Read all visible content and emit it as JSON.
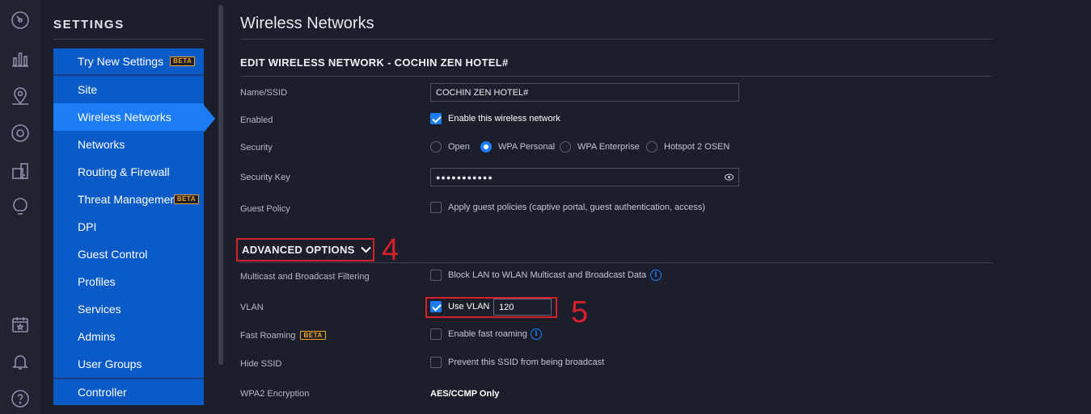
{
  "rail": {
    "icons": [
      "dashboard-icon",
      "statistics-icon",
      "map-icon",
      "devices-icon",
      "clients-icon",
      "insights-icon",
      "events-icon",
      "alerts-icon",
      "help-icon"
    ]
  },
  "nav": {
    "title": "SETTINGS",
    "try_new": "Try New Settings",
    "beta": "BETA",
    "items": [
      "Site",
      "Wireless Networks",
      "Networks",
      "Routing & Firewall",
      "Threat Management",
      "DPI",
      "Guest Control",
      "Profiles",
      "Services",
      "Admins",
      "User Groups"
    ],
    "controller": "Controller",
    "active": "Wireless Networks"
  },
  "main": {
    "page_title": "Wireless Networks",
    "section_title": "EDIT WIRELESS NETWORK - COCHIN ZEN HOTEL#",
    "fields": {
      "name_label": "Name/SSID",
      "name_value": "COCHIN ZEN HOTEL#",
      "enabled_label": "Enabled",
      "enabled_text": "Enable this wireless network",
      "enabled_checked": true,
      "security_label": "Security",
      "security_options": [
        "Open",
        "WPA Personal",
        "WPA Enterprise",
        "Hotspot 2 OSEN"
      ],
      "security_selected": "WPA Personal",
      "key_label": "Security Key",
      "key_value": "●●●●●●●●●●●",
      "guest_label": "Guest Policy",
      "guest_text": "Apply guest policies (captive portal, guest authentication, access)",
      "guest_checked": false
    },
    "advanced": {
      "toggle_label": "ADVANCED OPTIONS",
      "step_4": "4",
      "step_5": "5",
      "multicast_label": "Multicast and Broadcast Filtering",
      "multicast_text": "Block LAN to WLAN Multicast and Broadcast Data",
      "multicast_checked": false,
      "vlan_label": "VLAN",
      "vlan_text": "Use VLAN",
      "vlan_checked": true,
      "vlan_value": "120",
      "roaming_label": "Fast Roaming",
      "roaming_beta": "BETA",
      "roaming_text": "Enable fast roaming",
      "roaming_checked": false,
      "hide_label": "Hide SSID",
      "hide_text": "Prevent this SSID from being broadcast",
      "hide_checked": false,
      "wpa2_label": "WPA2 Encryption",
      "wpa2_value": "AES/CCMP Only"
    }
  },
  "colors": {
    "background": "#1c1e2b",
    "nav_blue": "#0a5ac8",
    "nav_active": "#1b7cf5",
    "annotation_red": "#d6202a",
    "beta_orange": "#f5a623"
  }
}
